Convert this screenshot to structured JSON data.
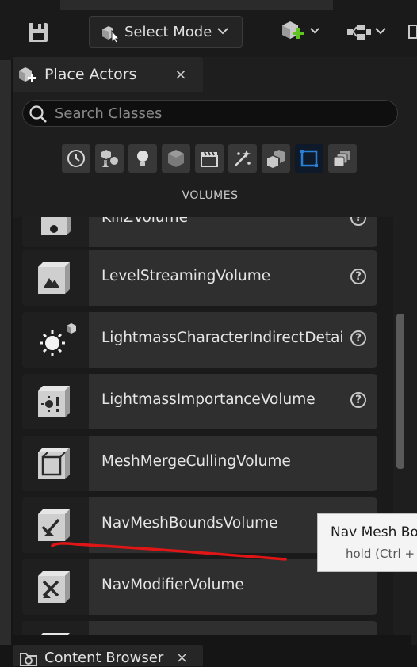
{
  "toolbar": {
    "mode_label": "Select Mode"
  },
  "panel": {
    "tab_title": "Place Actors",
    "close_glyph": "×",
    "search_placeholder": "Search Classes",
    "category_title": "VOLUMES",
    "categories": [
      {
        "icon": "recent-clock-icon"
      },
      {
        "icon": "basic-shapes-icon"
      },
      {
        "icon": "lights-icon"
      },
      {
        "icon": "shapes-cube-icon"
      },
      {
        "icon": "cinematic-clapper-icon"
      },
      {
        "icon": "visual-effects-icon"
      },
      {
        "icon": "geometry-icon"
      },
      {
        "icon": "volumes-icon",
        "active": true
      },
      {
        "icon": "all-classes-icon"
      }
    ],
    "items": [
      {
        "name": "KillZVolume",
        "help": "?"
      },
      {
        "name": "LevelStreamingVolume",
        "help": "?"
      },
      {
        "name": "LightmassCharacterIndirectDetailVolume",
        "help": "?"
      },
      {
        "name": "LightmassImportanceVolume",
        "help": "?"
      },
      {
        "name": "MeshMergeCullingVolume",
        "help": ""
      },
      {
        "name": "NavMeshBoundsVolume",
        "help": ""
      },
      {
        "name": "NavModifierVolume",
        "help": ""
      },
      {
        "name": "",
        "help": ""
      }
    ]
  },
  "tooltip": {
    "title": "Nav Mesh Bou",
    "hint": "hold (Ctrl + A"
  },
  "bottom_tab": {
    "title": "Content Browser",
    "close_glyph": "×"
  },
  "colors": {
    "annotation_stroke": "#e01515",
    "active_category": "#0e1a2a",
    "add_plus": "#5fc41f"
  }
}
